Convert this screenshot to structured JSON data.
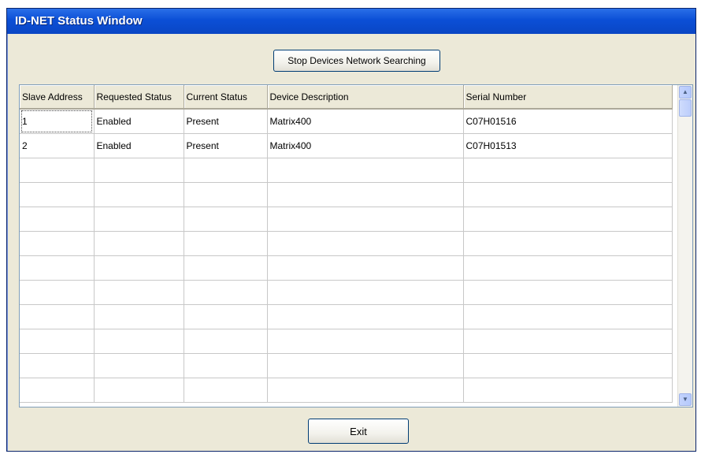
{
  "window": {
    "title": "ID-NET Status Window"
  },
  "toolbar": {
    "stop_label": "Stop Devices Network Searching"
  },
  "grid": {
    "columns": [
      "Slave Address",
      "Requested Status",
      "Current Status",
      "Device Description",
      "Serial Number"
    ],
    "rows": [
      [
        "1",
        "Enabled",
        "Present",
        "Matrix400",
        "C07H01516"
      ],
      [
        "2",
        "Enabled",
        "Present",
        "Matrix400",
        "C07H01513"
      ]
    ],
    "empty_rows": 10
  },
  "scrollbar": {
    "up_icon": "scroll-up-arrow-icon",
    "down_icon": "scroll-down-arrow-icon"
  },
  "footer": {
    "exit_label": "Exit"
  }
}
